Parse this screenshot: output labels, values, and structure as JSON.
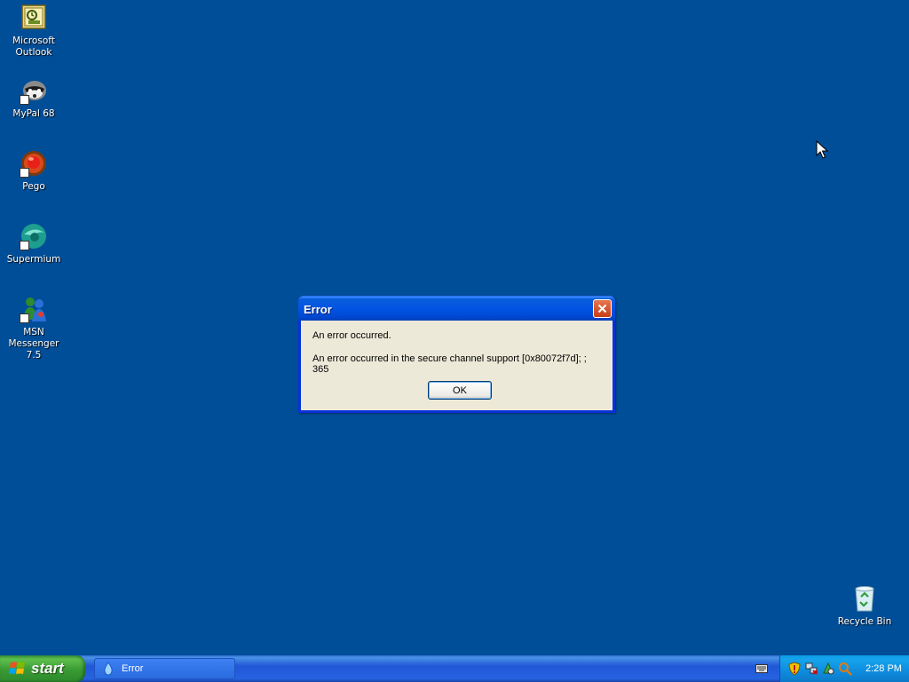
{
  "desktop": {
    "background_color": "#004E98",
    "icons": [
      {
        "label": "Microsoft Outlook",
        "icon": "outlook-icon"
      },
      {
        "label": "MyPal 68",
        "icon": "mypal-icon"
      },
      {
        "label": "Pego",
        "icon": "pego-icon"
      },
      {
        "label": "Supermium",
        "icon": "supermium-icon"
      },
      {
        "label": "MSN Messenger 7.5",
        "icon": "msn-messenger-icon"
      },
      {
        "label": "Recycle Bin",
        "icon": "recycle-bin-icon"
      }
    ]
  },
  "dialog": {
    "title": "Error",
    "message1": "An error occurred.",
    "message2": "An error occurred in the secure channel support [0x80072f7d]; ; 365",
    "ok_label": "OK",
    "close_icon": "close-icon"
  },
  "taskbar": {
    "start_label": "start",
    "tasks": [
      {
        "label": "Error",
        "icon": "app-icon"
      }
    ],
    "tray_icons": [
      "security-shield-icon",
      "network-icon",
      "update-icon",
      "search-icon"
    ],
    "clock": "2:28 PM"
  }
}
